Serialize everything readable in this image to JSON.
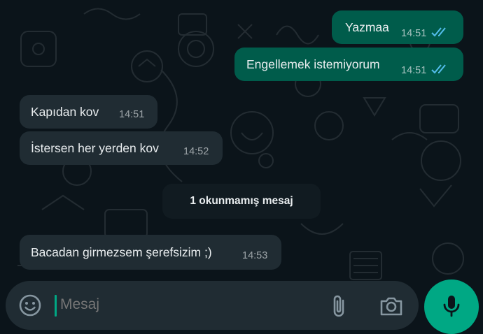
{
  "colors": {
    "background": "#0b141a",
    "outgoing_bubble": "#005c4b",
    "incoming_bubble": "#202c33",
    "read_tick": "#53bdeb",
    "accent": "#00a884"
  },
  "messages": [
    {
      "direction": "outgoing",
      "text": "Yazmaa",
      "time": "14:51",
      "status": "read"
    },
    {
      "direction": "outgoing",
      "text": "Engellemek istemiyorum",
      "time": "14:51",
      "status": "read"
    },
    {
      "direction": "incoming",
      "text": "Kapıdan kov",
      "time": "14:51"
    },
    {
      "direction": "incoming",
      "text": "İstersen her yerden kov",
      "time": "14:52"
    },
    {
      "direction": "incoming",
      "text": "Bacadan girmezsem şerefsizim ;)",
      "time": "14:53"
    }
  ],
  "unread_divider": {
    "label": "1 okunmamış mesaj"
  },
  "composer": {
    "placeholder": "Mesaj",
    "value": "",
    "emoji_icon": "emoji-smile-icon",
    "attach_icon": "paperclip-icon",
    "camera_icon": "camera-icon",
    "mic_icon": "microphone-icon"
  }
}
